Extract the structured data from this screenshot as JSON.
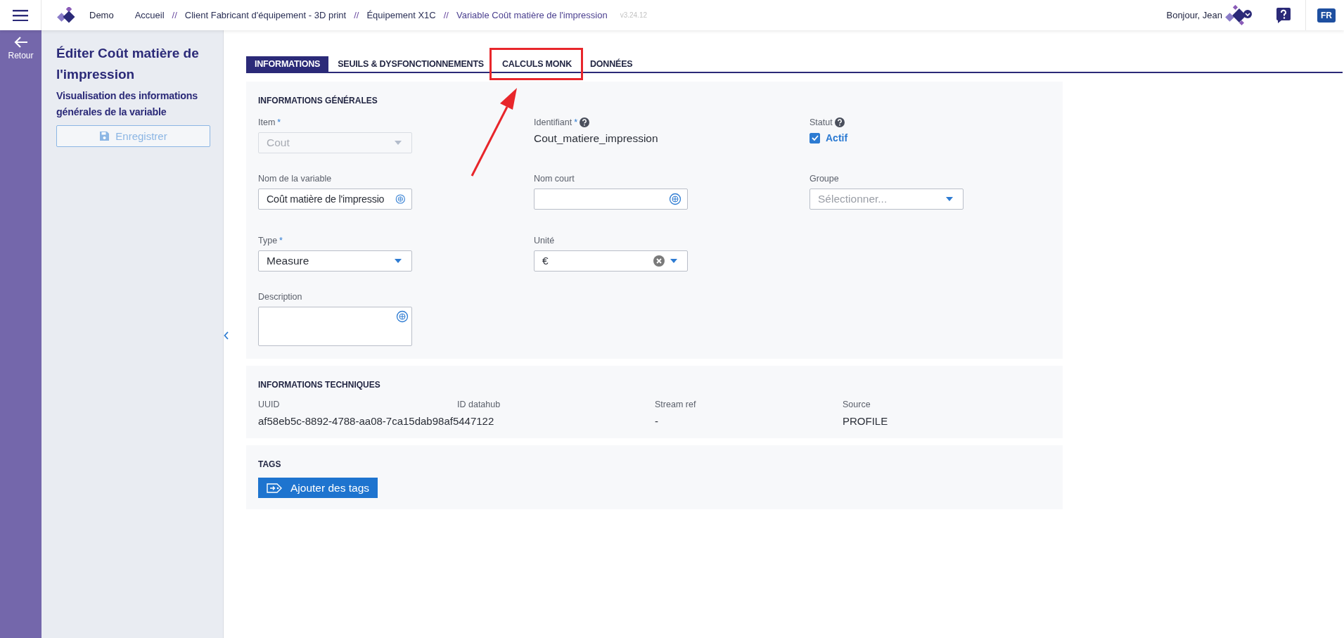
{
  "topbar": {
    "brand": "Demo",
    "breadcrumb": [
      {
        "label": "Accueil"
      },
      {
        "separator": "//",
        "label": "Client Fabricant d'équipement - 3D print"
      },
      {
        "separator": "//",
        "label": "Équipement X1C"
      },
      {
        "separator": "//",
        "label": "Variable Coût matière de l'impression"
      }
    ],
    "version": "v3.24.12",
    "greeting": "Bonjour, Jean",
    "language": "FR"
  },
  "rail": {
    "back_label": "Retour"
  },
  "side_panel": {
    "title": "Éditer Coût matière de l'impression",
    "subtitle": "Visualisation des informations générales de la variable",
    "save_button": {
      "label": "Enregistrer",
      "disabled": true
    }
  },
  "tabs": [
    {
      "label": "INFORMATIONS",
      "selected": true,
      "highlighted": false
    },
    {
      "label": "SEUILS & DYSFONCTIONNEMENTS",
      "selected": false,
      "highlighted": false
    },
    {
      "label": "CALCULS MONK",
      "selected": false,
      "highlighted": true
    },
    {
      "label": "DONNÉES",
      "selected": false,
      "highlighted": false
    }
  ],
  "general": {
    "heading": "INFORMATIONS GÉNÉRALES",
    "rows": [
      [
        {
          "kind": "select",
          "label": "Item",
          "required": "*",
          "value": "Cout",
          "disabled": true
        },
        {
          "kind": "display",
          "label": "Identifiant",
          "required": "*",
          "help": true,
          "value": "Cout_matiere_impression"
        },
        {
          "kind": "checkbox",
          "label": "Statut",
          "help": true,
          "value": "Actif",
          "checked": true
        }
      ],
      [
        {
          "kind": "text",
          "label": "Nom de la variable",
          "value": "Coût matière de l'impressio"
        },
        {
          "kind": "text",
          "label": "Nom court"
        },
        {
          "kind": "select",
          "label": "Groupe",
          "placeholder": "Sélectionner...",
          "disabled": false
        }
      ],
      [
        {
          "kind": "select",
          "label": "Type",
          "required": "*",
          "value": "Measure",
          "disabled": false
        },
        {
          "kind": "select",
          "label": "Unité",
          "value": "€",
          "clearable": true,
          "disabled": false
        }
      ],
      [
        {
          "kind": "textarea",
          "label": "Description"
        }
      ]
    ]
  },
  "technical": {
    "heading": "INFORMATIONS TECHNIQUES",
    "columns": [
      {
        "label": "UUID",
        "value": "af58eb5c-8892-4788-aa08-7ca15dab98af5447122"
      },
      {
        "label": "ID datahub"
      },
      {
        "label": "Stream ref",
        "value": "-"
      },
      {
        "label": "Source",
        "value": "PROFILE"
      }
    ]
  },
  "tags": {
    "heading": "TAGS",
    "button": "Ajouter des tags"
  }
}
